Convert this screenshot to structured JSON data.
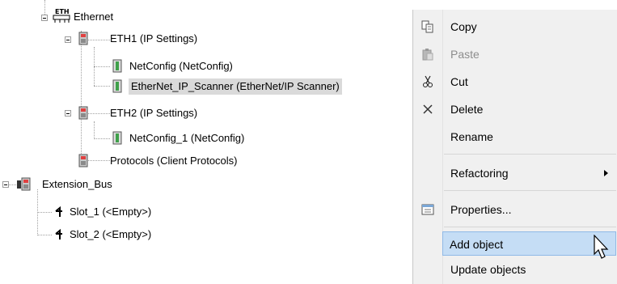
{
  "tree": {
    "partial_top_label": "",
    "nodes": [
      {
        "label": "Ethernet"
      },
      {
        "label": "ETH1 (IP Settings)"
      },
      {
        "label": "NetConfig (NetConfig)"
      },
      {
        "label": "EtherNet_IP_Scanner (EtherNet/IP Scanner)"
      },
      {
        "label": "ETH2 (IP Settings)"
      },
      {
        "label": "NetConfig_1 (NetConfig)"
      },
      {
        "label": "Protocols (Client Protocols)"
      },
      {
        "label": "Extension_Bus"
      },
      {
        "label": "Slot_1 (<Empty>)"
      },
      {
        "label": "Slot_2 (<Empty>)"
      }
    ],
    "ethernet_icon_text": "ETH"
  },
  "context_menu": {
    "items": [
      {
        "label": "Copy",
        "icon": "copy-icon",
        "disabled": false
      },
      {
        "label": "Paste",
        "icon": "paste-icon",
        "disabled": true
      },
      {
        "label": "Cut",
        "icon": "cut-icon",
        "disabled": false
      },
      {
        "label": "Delete",
        "icon": "delete-icon",
        "disabled": false
      },
      {
        "label": "Rename",
        "icon": "",
        "disabled": false
      },
      {
        "label": "Refactoring",
        "icon": "",
        "disabled": false,
        "submenu": true
      },
      {
        "label": "Properties...",
        "icon": "properties-icon",
        "disabled": false
      },
      {
        "label": "Add object",
        "icon": "",
        "disabled": false,
        "highlighted": true
      },
      {
        "label": "Update objects",
        "icon": "",
        "disabled": false
      }
    ]
  },
  "colors": {
    "menu_bg": "#f0f0f0",
    "highlight_bg": "#c5ddf5",
    "highlight_border": "#8fb9e6",
    "selection_bg": "#dadada",
    "disabled_text": "#8d8d8d"
  }
}
